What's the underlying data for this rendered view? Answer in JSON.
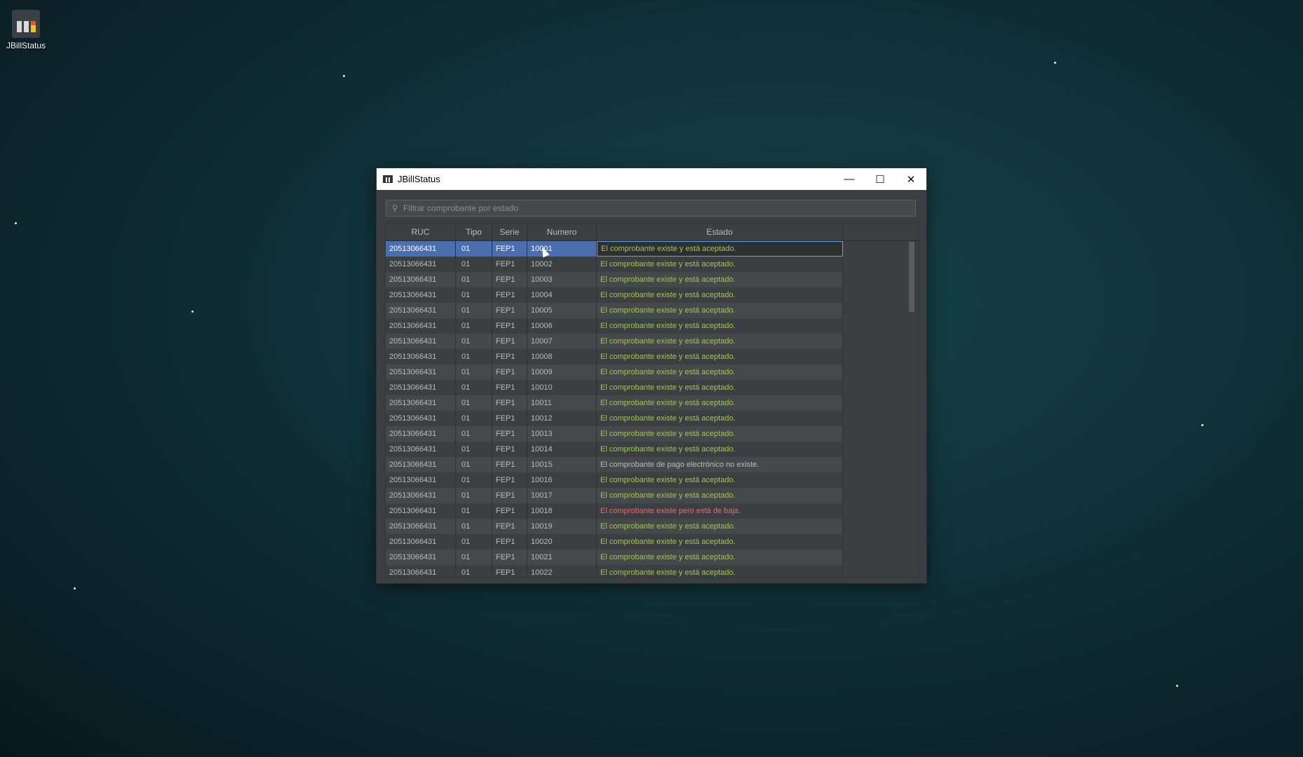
{
  "desktop": {
    "icon_label": "JBillStatus"
  },
  "window": {
    "title": "JBillStatus",
    "minimize_glyph": "—",
    "maximize_glyph": "☐",
    "close_glyph": "✕"
  },
  "search": {
    "placeholder": "Filtrar comprobante por estado",
    "value": ""
  },
  "table": {
    "headers": {
      "ruc": "RUC",
      "tipo": "Tipo",
      "serie": "Serie",
      "numero": "Numero",
      "estado": "Estado"
    },
    "rows": [
      {
        "ruc": "20513066431",
        "tipo": "01",
        "serie": "FEP1",
        "numero": "10001",
        "estado": "El comprobante existe y está aceptado.",
        "status": "ok",
        "selected": true
      },
      {
        "ruc": "20513066431",
        "tipo": "01",
        "serie": "FEP1",
        "numero": "10002",
        "estado": "El comprobante existe y está aceptado.",
        "status": "ok"
      },
      {
        "ruc": "20513066431",
        "tipo": "01",
        "serie": "FEP1",
        "numero": "10003",
        "estado": "El comprobante existe y está aceptado.",
        "status": "ok"
      },
      {
        "ruc": "20513066431",
        "tipo": "01",
        "serie": "FEP1",
        "numero": "10004",
        "estado": "El comprobante existe y está aceptado.",
        "status": "ok"
      },
      {
        "ruc": "20513066431",
        "tipo": "01",
        "serie": "FEP1",
        "numero": "10005",
        "estado": "El comprobante existe y está aceptado.",
        "status": "ok"
      },
      {
        "ruc": "20513066431",
        "tipo": "01",
        "serie": "FEP1",
        "numero": "10006",
        "estado": "El comprobante existe y está aceptado.",
        "status": "ok"
      },
      {
        "ruc": "20513066431",
        "tipo": "01",
        "serie": "FEP1",
        "numero": "10007",
        "estado": "El comprobante existe y está aceptado.",
        "status": "ok"
      },
      {
        "ruc": "20513066431",
        "tipo": "01",
        "serie": "FEP1",
        "numero": "10008",
        "estado": "El comprobante existe y está aceptado.",
        "status": "ok"
      },
      {
        "ruc": "20513066431",
        "tipo": "01",
        "serie": "FEP1",
        "numero": "10009",
        "estado": "El comprobante existe y está aceptado.",
        "status": "ok"
      },
      {
        "ruc": "20513066431",
        "tipo": "01",
        "serie": "FEP1",
        "numero": "10010",
        "estado": "El comprobante existe y está aceptado.",
        "status": "ok"
      },
      {
        "ruc": "20513066431",
        "tipo": "01",
        "serie": "FEP1",
        "numero": "10011",
        "estado": "El comprobante existe y está aceptado.",
        "status": "ok"
      },
      {
        "ruc": "20513066431",
        "tipo": "01",
        "serie": "FEP1",
        "numero": "10012",
        "estado": "El comprobante existe y está aceptado.",
        "status": "ok"
      },
      {
        "ruc": "20513066431",
        "tipo": "01",
        "serie": "FEP1",
        "numero": "10013",
        "estado": "El comprobante existe y está aceptado.",
        "status": "ok"
      },
      {
        "ruc": "20513066431",
        "tipo": "01",
        "serie": "FEP1",
        "numero": "10014",
        "estado": "El comprobante existe y está aceptado.",
        "status": "ok"
      },
      {
        "ruc": "20513066431",
        "tipo": "01",
        "serie": "FEP1",
        "numero": "10015",
        "estado": "El comprobante de pago electrónico no existe.",
        "status": "none"
      },
      {
        "ruc": "20513066431",
        "tipo": "01",
        "serie": "FEP1",
        "numero": "10016",
        "estado": "El comprobante existe y está aceptado.",
        "status": "ok"
      },
      {
        "ruc": "20513066431",
        "tipo": "01",
        "serie": "FEP1",
        "numero": "10017",
        "estado": "El comprobante existe y está aceptado.",
        "status": "ok"
      },
      {
        "ruc": "20513066431",
        "tipo": "01",
        "serie": "FEP1",
        "numero": "10018",
        "estado": "El comprobante existe pero está de baja.",
        "status": "baja"
      },
      {
        "ruc": "20513066431",
        "tipo": "01",
        "serie": "FEP1",
        "numero": "10019",
        "estado": "El comprobante existe y está aceptado.",
        "status": "ok"
      },
      {
        "ruc": "20513066431",
        "tipo": "01",
        "serie": "FEP1",
        "numero": "10020",
        "estado": "El comprobante existe y está aceptado.",
        "status": "ok"
      },
      {
        "ruc": "20513066431",
        "tipo": "01",
        "serie": "FEP1",
        "numero": "10021",
        "estado": "El comprobante existe y está aceptado.",
        "status": "ok"
      },
      {
        "ruc": "20513066431",
        "tipo": "01",
        "serie": "FEP1",
        "numero": "10022",
        "estado": "El comprobante existe y está aceptado.",
        "status": "ok"
      }
    ]
  },
  "colors": {
    "accepted": "#a5c25c",
    "not_exists": "#bbbbbb",
    "baja": "#e06c75",
    "selection": "#4b6eaf"
  }
}
